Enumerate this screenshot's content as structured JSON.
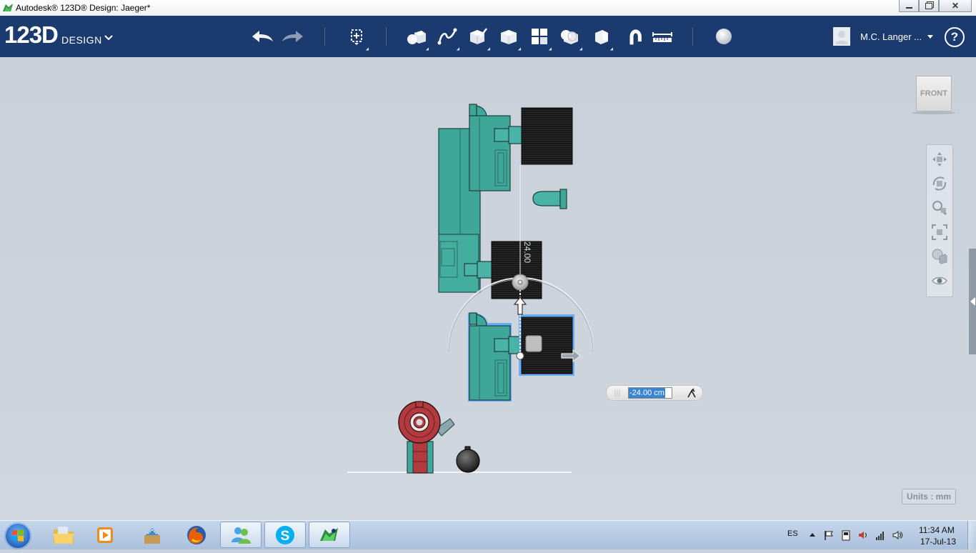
{
  "window": {
    "title": "Autodesk® 123D® Design: Jaeger*",
    "controls": [
      "minimize",
      "restore",
      "close"
    ]
  },
  "app": {
    "logo_main": "123D",
    "logo_sub": "DESIGN",
    "toolbar": [
      "undo-icon",
      "redo-icon",
      "transform-icon",
      "primitives-icon",
      "sketch-icon",
      "construct-icon",
      "modify-icon",
      "pattern-icon",
      "group-icon",
      "combine-icon",
      "snap-icon",
      "measure-icon",
      "material-icon"
    ],
    "user": {
      "name": "M.C. Langer ..."
    },
    "help_label": "?"
  },
  "viewport": {
    "viewcube_label": "FRONT",
    "dimension_label": "24.00",
    "measure_value": "-24.00 cm",
    "units_label": "Units : mm",
    "nav_tools": [
      "pan-icon",
      "orbit-icon",
      "zoom-icon",
      "fit-icon",
      "view-mode-icon",
      "visibility-icon"
    ],
    "colors": {
      "teal": "#3ea79a",
      "selection": "#4da3ff",
      "red_part": "#b33a3e",
      "black_part": "#1c1c1c"
    }
  },
  "taskbar": {
    "apps": [
      "file-explorer-icon",
      "media-player-icon",
      "ink-icon",
      "firefox-icon",
      "messenger-icon",
      "skype-icon",
      "123d-design-icon"
    ],
    "language": "ES",
    "time": "11:34 AM",
    "date": "17-Jul-13"
  }
}
